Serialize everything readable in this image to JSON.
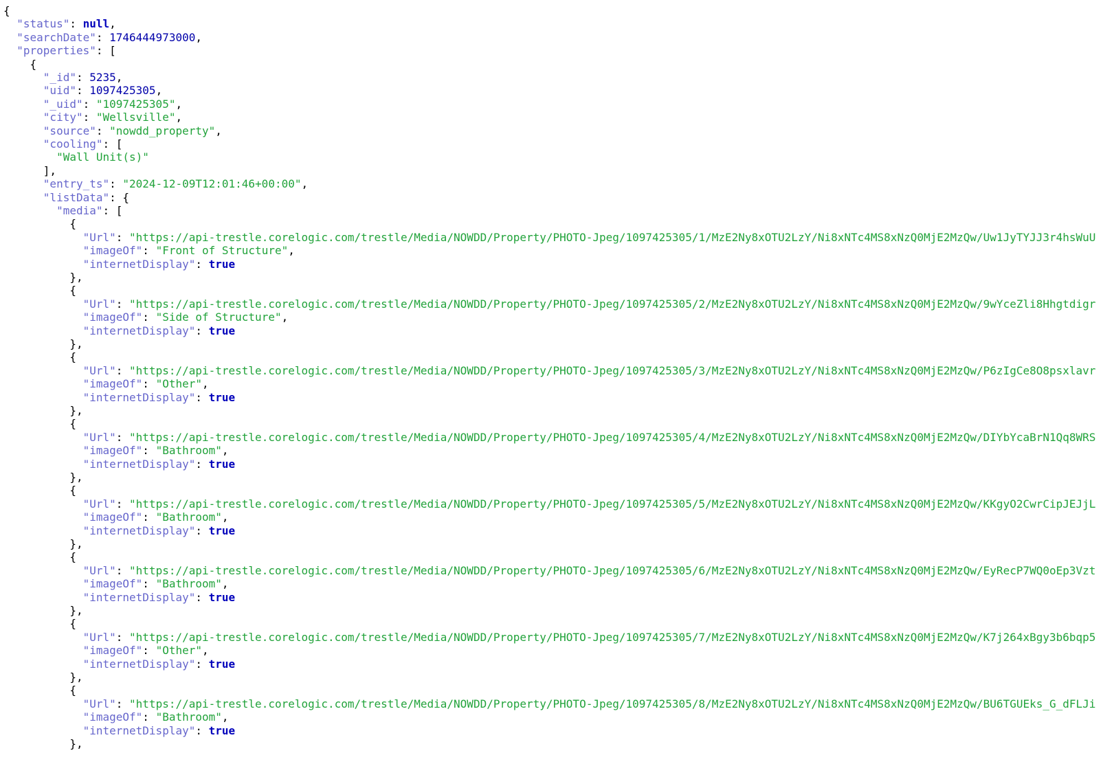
{
  "viewer": {
    "theme": {
      "key_color": "#6666cc",
      "number_color": "#0000aa",
      "string_color": "#22a33b",
      "keyword_color": "#0000bb",
      "punctuation_color": "#000000",
      "background": "#ffffff"
    },
    "lines": [
      [
        {
          "t": "p",
          "v": "{"
        }
      ],
      [
        {
          "t": "p",
          "v": "  "
        },
        {
          "t": "key",
          "v": "\"status\""
        },
        {
          "t": "p",
          "v": ": "
        },
        {
          "t": "kw",
          "v": "null"
        },
        {
          "t": "p",
          "v": ","
        }
      ],
      [
        {
          "t": "p",
          "v": "  "
        },
        {
          "t": "key",
          "v": "\"searchDate\""
        },
        {
          "t": "p",
          "v": ": "
        },
        {
          "t": "num",
          "v": "1746444973000"
        },
        {
          "t": "p",
          "v": ","
        }
      ],
      [
        {
          "t": "p",
          "v": "  "
        },
        {
          "t": "key",
          "v": "\"properties\""
        },
        {
          "t": "p",
          "v": ": ["
        }
      ],
      [
        {
          "t": "p",
          "v": "    {"
        }
      ],
      [
        {
          "t": "p",
          "v": "      "
        },
        {
          "t": "key",
          "v": "\"_id\""
        },
        {
          "t": "p",
          "v": ": "
        },
        {
          "t": "num",
          "v": "5235"
        },
        {
          "t": "p",
          "v": ","
        }
      ],
      [
        {
          "t": "p",
          "v": "      "
        },
        {
          "t": "key",
          "v": "\"uid\""
        },
        {
          "t": "p",
          "v": ": "
        },
        {
          "t": "num",
          "v": "1097425305"
        },
        {
          "t": "p",
          "v": ","
        }
      ],
      [
        {
          "t": "p",
          "v": "      "
        },
        {
          "t": "key",
          "v": "\"_uid\""
        },
        {
          "t": "p",
          "v": ": "
        },
        {
          "t": "str",
          "v": "\"1097425305\""
        },
        {
          "t": "p",
          "v": ","
        }
      ],
      [
        {
          "t": "p",
          "v": "      "
        },
        {
          "t": "key",
          "v": "\"city\""
        },
        {
          "t": "p",
          "v": ": "
        },
        {
          "t": "str",
          "v": "\"Wellsville\""
        },
        {
          "t": "p",
          "v": ","
        }
      ],
      [
        {
          "t": "p",
          "v": "      "
        },
        {
          "t": "key",
          "v": "\"source\""
        },
        {
          "t": "p",
          "v": ": "
        },
        {
          "t": "str",
          "v": "\"nowdd_property\""
        },
        {
          "t": "p",
          "v": ","
        }
      ],
      [
        {
          "t": "p",
          "v": "      "
        },
        {
          "t": "key",
          "v": "\"cooling\""
        },
        {
          "t": "p",
          "v": ": ["
        }
      ],
      [
        {
          "t": "p",
          "v": "        "
        },
        {
          "t": "str",
          "v": "\"Wall Unit(s)\""
        }
      ],
      [
        {
          "t": "p",
          "v": "      ],"
        }
      ],
      [
        {
          "t": "p",
          "v": "      "
        },
        {
          "t": "key",
          "v": "\"entry_ts\""
        },
        {
          "t": "p",
          "v": ": "
        },
        {
          "t": "str",
          "v": "\"2024-12-09T12:01:46+00:00\""
        },
        {
          "t": "p",
          "v": ","
        }
      ],
      [
        {
          "t": "p",
          "v": "      "
        },
        {
          "t": "key",
          "v": "\"listData\""
        },
        {
          "t": "p",
          "v": ": {"
        }
      ],
      [
        {
          "t": "p",
          "v": "        "
        },
        {
          "t": "key",
          "v": "\"media\""
        },
        {
          "t": "p",
          "v": ": ["
        }
      ],
      [
        {
          "t": "p",
          "v": "          {"
        }
      ],
      [
        {
          "t": "p",
          "v": "            "
        },
        {
          "t": "key",
          "v": "\"Url\""
        },
        {
          "t": "p",
          "v": ": "
        },
        {
          "t": "str",
          "v": "\"https://api-trestle.corelogic.com/trestle/Media/NOWDD/Property/PHOTO-Jpeg/1097425305/1/MzE2Ny8xOTU2LzY/Ni8xNTc4MS8xNzQ0MjE2MzQw/Uw1JyTYJJ3r4hsWuU"
        }
      ],
      [
        {
          "t": "p",
          "v": "            "
        },
        {
          "t": "key",
          "v": "\"imageOf\""
        },
        {
          "t": "p",
          "v": ": "
        },
        {
          "t": "str",
          "v": "\"Front of Structure\""
        },
        {
          "t": "p",
          "v": ","
        }
      ],
      [
        {
          "t": "p",
          "v": "            "
        },
        {
          "t": "key",
          "v": "\"internetDisplay\""
        },
        {
          "t": "p",
          "v": ": "
        },
        {
          "t": "kw",
          "v": "true"
        }
      ],
      [
        {
          "t": "p",
          "v": "          },"
        }
      ],
      [
        {
          "t": "p",
          "v": "          {"
        }
      ],
      [
        {
          "t": "p",
          "v": "            "
        },
        {
          "t": "key",
          "v": "\"Url\""
        },
        {
          "t": "p",
          "v": ": "
        },
        {
          "t": "str",
          "v": "\"https://api-trestle.corelogic.com/trestle/Media/NOWDD/Property/PHOTO-Jpeg/1097425305/2/MzE2Ny8xOTU2LzY/Ni8xNTc4MS8xNzQ0MjE2MzQw/9wYceZli8Hhgtdigr"
        }
      ],
      [
        {
          "t": "p",
          "v": "            "
        },
        {
          "t": "key",
          "v": "\"imageOf\""
        },
        {
          "t": "p",
          "v": ": "
        },
        {
          "t": "str",
          "v": "\"Side of Structure\""
        },
        {
          "t": "p",
          "v": ","
        }
      ],
      [
        {
          "t": "p",
          "v": "            "
        },
        {
          "t": "key",
          "v": "\"internetDisplay\""
        },
        {
          "t": "p",
          "v": ": "
        },
        {
          "t": "kw",
          "v": "true"
        }
      ],
      [
        {
          "t": "p",
          "v": "          },"
        }
      ],
      [
        {
          "t": "p",
          "v": "          {"
        }
      ],
      [
        {
          "t": "p",
          "v": "            "
        },
        {
          "t": "key",
          "v": "\"Url\""
        },
        {
          "t": "p",
          "v": ": "
        },
        {
          "t": "str",
          "v": "\"https://api-trestle.corelogic.com/trestle/Media/NOWDD/Property/PHOTO-Jpeg/1097425305/3/MzE2Ny8xOTU2LzY/Ni8xNTc4MS8xNzQ0MjE2MzQw/P6zIgCe8O8psxlavr"
        }
      ],
      [
        {
          "t": "p",
          "v": "            "
        },
        {
          "t": "key",
          "v": "\"imageOf\""
        },
        {
          "t": "p",
          "v": ": "
        },
        {
          "t": "str",
          "v": "\"Other\""
        },
        {
          "t": "p",
          "v": ","
        }
      ],
      [
        {
          "t": "p",
          "v": "            "
        },
        {
          "t": "key",
          "v": "\"internetDisplay\""
        },
        {
          "t": "p",
          "v": ": "
        },
        {
          "t": "kw",
          "v": "true"
        }
      ],
      [
        {
          "t": "p",
          "v": "          },"
        }
      ],
      [
        {
          "t": "p",
          "v": "          {"
        }
      ],
      [
        {
          "t": "p",
          "v": "            "
        },
        {
          "t": "key",
          "v": "\"Url\""
        },
        {
          "t": "p",
          "v": ": "
        },
        {
          "t": "str",
          "v": "\"https://api-trestle.corelogic.com/trestle/Media/NOWDD/Property/PHOTO-Jpeg/1097425305/4/MzE2Ny8xOTU2LzY/Ni8xNTc4MS8xNzQ0MjE2MzQw/DIYbYcaBrN1Qq8WRS"
        }
      ],
      [
        {
          "t": "p",
          "v": "            "
        },
        {
          "t": "key",
          "v": "\"imageOf\""
        },
        {
          "t": "p",
          "v": ": "
        },
        {
          "t": "str",
          "v": "\"Bathroom\""
        },
        {
          "t": "p",
          "v": ","
        }
      ],
      [
        {
          "t": "p",
          "v": "            "
        },
        {
          "t": "key",
          "v": "\"internetDisplay\""
        },
        {
          "t": "p",
          "v": ": "
        },
        {
          "t": "kw",
          "v": "true"
        }
      ],
      [
        {
          "t": "p",
          "v": "          },"
        }
      ],
      [
        {
          "t": "p",
          "v": "          {"
        }
      ],
      [
        {
          "t": "p",
          "v": "            "
        },
        {
          "t": "key",
          "v": "\"Url\""
        },
        {
          "t": "p",
          "v": ": "
        },
        {
          "t": "str",
          "v": "\"https://api-trestle.corelogic.com/trestle/Media/NOWDD/Property/PHOTO-Jpeg/1097425305/5/MzE2Ny8xOTU2LzY/Ni8xNTc4MS8xNzQ0MjE2MzQw/KKgyO2CwrCipJEJjL"
        }
      ],
      [
        {
          "t": "p",
          "v": "            "
        },
        {
          "t": "key",
          "v": "\"imageOf\""
        },
        {
          "t": "p",
          "v": ": "
        },
        {
          "t": "str",
          "v": "\"Bathroom\""
        },
        {
          "t": "p",
          "v": ","
        }
      ],
      [
        {
          "t": "p",
          "v": "            "
        },
        {
          "t": "key",
          "v": "\"internetDisplay\""
        },
        {
          "t": "p",
          "v": ": "
        },
        {
          "t": "kw",
          "v": "true"
        }
      ],
      [
        {
          "t": "p",
          "v": "          },"
        }
      ],
      [
        {
          "t": "p",
          "v": "          {"
        }
      ],
      [
        {
          "t": "p",
          "v": "            "
        },
        {
          "t": "key",
          "v": "\"Url\""
        },
        {
          "t": "p",
          "v": ": "
        },
        {
          "t": "str",
          "v": "\"https://api-trestle.corelogic.com/trestle/Media/NOWDD/Property/PHOTO-Jpeg/1097425305/6/MzE2Ny8xOTU2LzY/Ni8xNTc4MS8xNzQ0MjE2MzQw/EyRecP7WQ0oEp3Vzt"
        }
      ],
      [
        {
          "t": "p",
          "v": "            "
        },
        {
          "t": "key",
          "v": "\"imageOf\""
        },
        {
          "t": "p",
          "v": ": "
        },
        {
          "t": "str",
          "v": "\"Bathroom\""
        },
        {
          "t": "p",
          "v": ","
        }
      ],
      [
        {
          "t": "p",
          "v": "            "
        },
        {
          "t": "key",
          "v": "\"internetDisplay\""
        },
        {
          "t": "p",
          "v": ": "
        },
        {
          "t": "kw",
          "v": "true"
        }
      ],
      [
        {
          "t": "p",
          "v": "          },"
        }
      ],
      [
        {
          "t": "p",
          "v": "          {"
        }
      ],
      [
        {
          "t": "p",
          "v": "            "
        },
        {
          "t": "key",
          "v": "\"Url\""
        },
        {
          "t": "p",
          "v": ": "
        },
        {
          "t": "str",
          "v": "\"https://api-trestle.corelogic.com/trestle/Media/NOWDD/Property/PHOTO-Jpeg/1097425305/7/MzE2Ny8xOTU2LzY/Ni8xNTc4MS8xNzQ0MjE2MzQw/K7j264xBgy3b6bqp5"
        }
      ],
      [
        {
          "t": "p",
          "v": "            "
        },
        {
          "t": "key",
          "v": "\"imageOf\""
        },
        {
          "t": "p",
          "v": ": "
        },
        {
          "t": "str",
          "v": "\"Other\""
        },
        {
          "t": "p",
          "v": ","
        }
      ],
      [
        {
          "t": "p",
          "v": "            "
        },
        {
          "t": "key",
          "v": "\"internetDisplay\""
        },
        {
          "t": "p",
          "v": ": "
        },
        {
          "t": "kw",
          "v": "true"
        }
      ],
      [
        {
          "t": "p",
          "v": "          },"
        }
      ],
      [
        {
          "t": "p",
          "v": "          {"
        }
      ],
      [
        {
          "t": "p",
          "v": "            "
        },
        {
          "t": "key",
          "v": "\"Url\""
        },
        {
          "t": "p",
          "v": ": "
        },
        {
          "t": "str",
          "v": "\"https://api-trestle.corelogic.com/trestle/Media/NOWDD/Property/PHOTO-Jpeg/1097425305/8/MzE2Ny8xOTU2LzY/Ni8xNTc4MS8xNzQ0MjE2MzQw/BU6TGUEks_G_dFLJi"
        }
      ],
      [
        {
          "t": "p",
          "v": "            "
        },
        {
          "t": "key",
          "v": "\"imageOf\""
        },
        {
          "t": "p",
          "v": ": "
        },
        {
          "t": "str",
          "v": "\"Bathroom\""
        },
        {
          "t": "p",
          "v": ","
        }
      ],
      [
        {
          "t": "p",
          "v": "            "
        },
        {
          "t": "key",
          "v": "\"internetDisplay\""
        },
        {
          "t": "p",
          "v": ": "
        },
        {
          "t": "kw",
          "v": "true"
        }
      ],
      [
        {
          "t": "p",
          "v": "          },"
        }
      ]
    ]
  }
}
